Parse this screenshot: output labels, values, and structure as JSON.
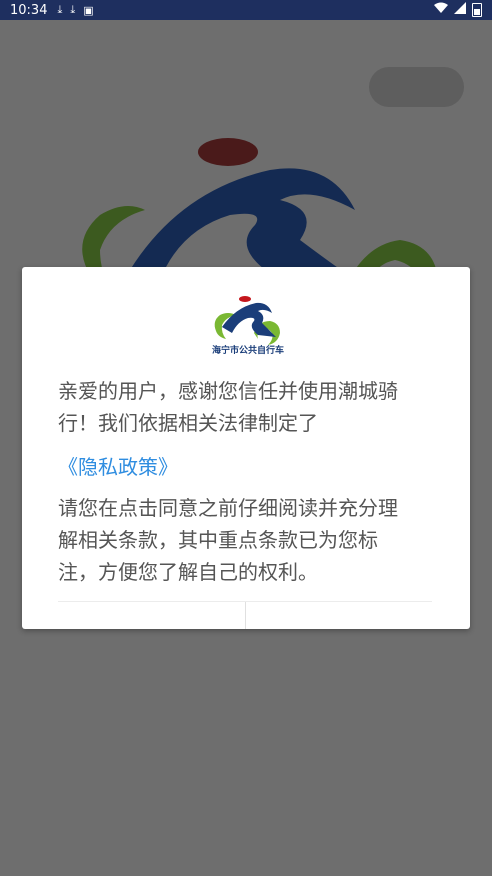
{
  "status_bar": {
    "time": "10:34",
    "notification_icons": [
      "download-icon",
      "download-icon",
      "a-icon"
    ],
    "system_icons": [
      "wifi-icon",
      "signal-icon",
      "battery-icon"
    ]
  },
  "dialog": {
    "logo_caption": "海宁市公共自行车",
    "paragraph1": "亲爱的用户，感谢您信任并使用潮城骑行！我们依据相关法律制定了",
    "policy_link": "《隐私政策》",
    "paragraph2": "请您在点击同意之前仔细阅读并充分理解相关条款，其中重点条款已为您标注，方便您了解自己的权利。"
  },
  "colors": {
    "status_bar": "#1e2f5f",
    "link": "#2f8de0",
    "logo_blue": "#1b3e7a",
    "logo_red": "#c4161c",
    "logo_green": "#7ab833",
    "overlay": "#6e6e6e"
  }
}
